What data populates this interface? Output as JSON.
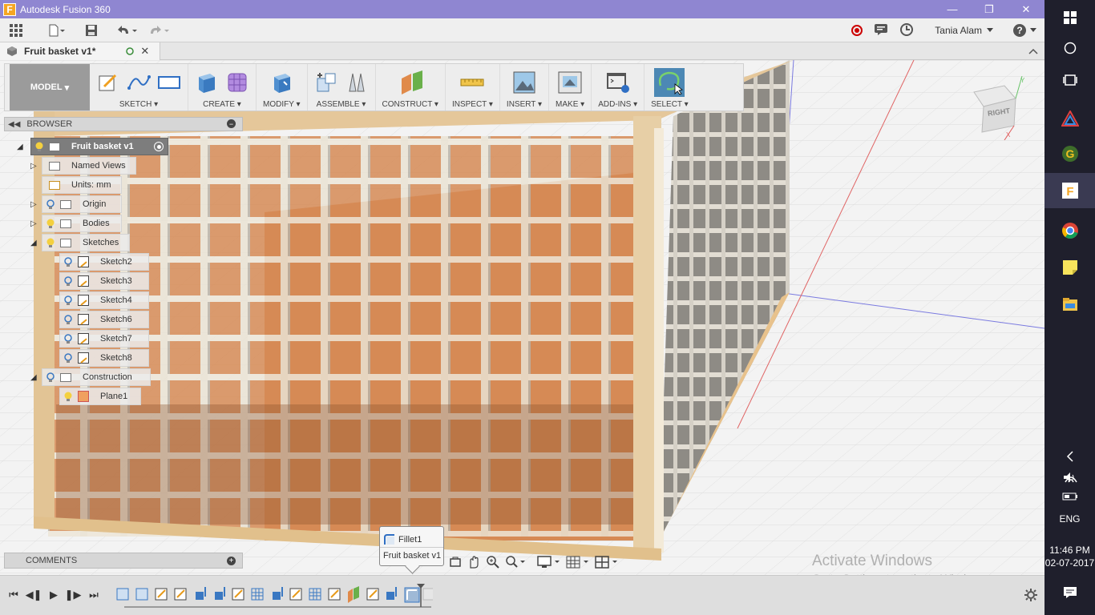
{
  "window": {
    "title": "Autodesk Fusion 360",
    "logo_letter": "F"
  },
  "quick_access": {
    "user_name": "Tania Alam"
  },
  "document_tab": {
    "name": "Fruit basket v1*"
  },
  "toolbar": {
    "workspace": "MODEL",
    "groups": [
      {
        "label": "SKETCH"
      },
      {
        "label": "CREATE"
      },
      {
        "label": "MODIFY"
      },
      {
        "label": "ASSEMBLE"
      },
      {
        "label": "CONSTRUCT"
      },
      {
        "label": "INSPECT"
      },
      {
        "label": "INSERT"
      },
      {
        "label": "MAKE"
      },
      {
        "label": "ADD-INS"
      },
      {
        "label": "SELECT"
      }
    ]
  },
  "browser": {
    "header": "BROWSER",
    "root": "Fruit basket v1",
    "items": [
      {
        "label": "Named Views"
      },
      {
        "label": "Units: mm"
      },
      {
        "label": "Origin"
      },
      {
        "label": "Bodies"
      },
      {
        "label": "Sketches"
      },
      {
        "label": "Sketch2"
      },
      {
        "label": "Sketch3"
      },
      {
        "label": "Sketch4"
      },
      {
        "label": "Sketch6"
      },
      {
        "label": "Sketch7"
      },
      {
        "label": "Sketch8"
      },
      {
        "label": "Construction"
      },
      {
        "label": "Plane1"
      }
    ]
  },
  "comments": {
    "header": "COMMENTS"
  },
  "tooltip": {
    "feature": "Fillet1",
    "document": "Fruit basket v1"
  },
  "viewcube": {
    "face": "RIGHT"
  },
  "watermark": {
    "line1": "Activate Windows",
    "line2": "Go to Settings to activate Windows."
  },
  "taskbar": {
    "language": "ENG",
    "time": "11:46 PM",
    "date": "02-07-2017"
  },
  "colors": {
    "titlebar": "#8f86d1",
    "accent_orange": "#f5a623",
    "basket_wood": "#e5c79a",
    "basket_inner": "#d68a55"
  }
}
